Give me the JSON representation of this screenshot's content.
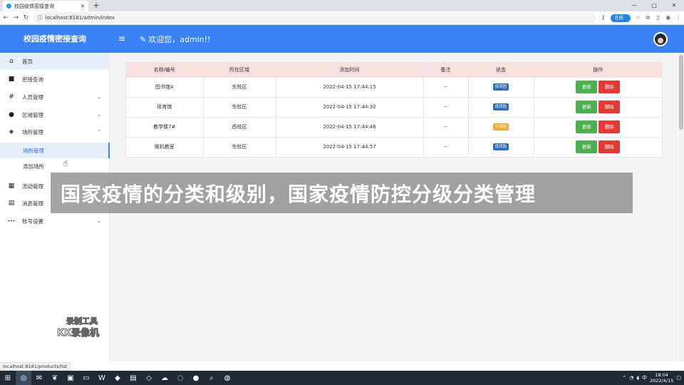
{
  "browser": {
    "tab_title": "校园疫情密接查询",
    "url": "localhost:8181/admin/index",
    "status_url": "localhost:8181/products/list",
    "ext_pill": "在线上传"
  },
  "header": {
    "app_title": "校园疫情密接查询",
    "menu_icon": "≡",
    "welcome": "欢迎您，admin!!"
  },
  "sidebar": {
    "items": [
      {
        "label": "首页",
        "icon": "home-icon",
        "glyph": "⌂"
      },
      {
        "label": "密接查询",
        "icon": "folder-icon",
        "glyph": "■"
      },
      {
        "label": "人员管理",
        "icon": "hash-icon",
        "glyph": "#",
        "chev": "⌄"
      },
      {
        "label": "区域管理",
        "icon": "circle-icon",
        "glyph": "●",
        "chev": "⌄"
      },
      {
        "label": "场所管理",
        "icon": "box-icon",
        "glyph": "◈",
        "chev": "⌃"
      },
      {
        "label": "流动管理",
        "icon": "grid-icon",
        "glyph": "▦",
        "chev": "⌄"
      },
      {
        "label": "消息管理",
        "icon": "file-icon",
        "glyph": "▤",
        "chev": "⌄"
      },
      {
        "label": "账号设置",
        "icon": "dots-icon",
        "glyph": "•••",
        "chev": "⌄"
      }
    ],
    "sub_items": [
      "场所管理",
      "添加场所"
    ]
  },
  "table": {
    "headers": [
      "名称/编号",
      "所在区域",
      "添加时间",
      "备注",
      "状态",
      "操作"
    ],
    "rows": [
      {
        "name": "图书馆A",
        "area": "东校区",
        "time": "2022-04-15 17:44:15",
        "note": "--",
        "status": "低风险",
        "status_color": "#2f6fb5"
      },
      {
        "name": "体育馆",
        "area": "东校区",
        "time": "2022-04-15 17:44:32",
        "note": "--",
        "status": "低风险",
        "status_color": "#2f6fb5"
      },
      {
        "name": "教学楼7#",
        "area": "西校区",
        "time": "2022-04-15 17:44:46",
        "note": "--",
        "status": "中风险",
        "status_color": "#f0a83a"
      },
      {
        "name": "微机教室",
        "area": "东校区",
        "time": "2022-04-15 17:44:57",
        "note": "--",
        "status": "低风险",
        "status_color": "#2f6fb5"
      }
    ],
    "update_label": "更新",
    "delete_label": "删除"
  },
  "overlay": {
    "banner": "国家疫情的分类和级别，国家疫情防控分级分类管理",
    "watermark_line1": "录制工具",
    "watermark_line2": "KK录像机"
  },
  "taskbar": {
    "time": "18:04",
    "date": "2022/4/15"
  },
  "colors": {
    "brand": "#3b82f6",
    "update": "#4caf50",
    "delete": "#e53935",
    "table_header": "#f9e0e0"
  }
}
